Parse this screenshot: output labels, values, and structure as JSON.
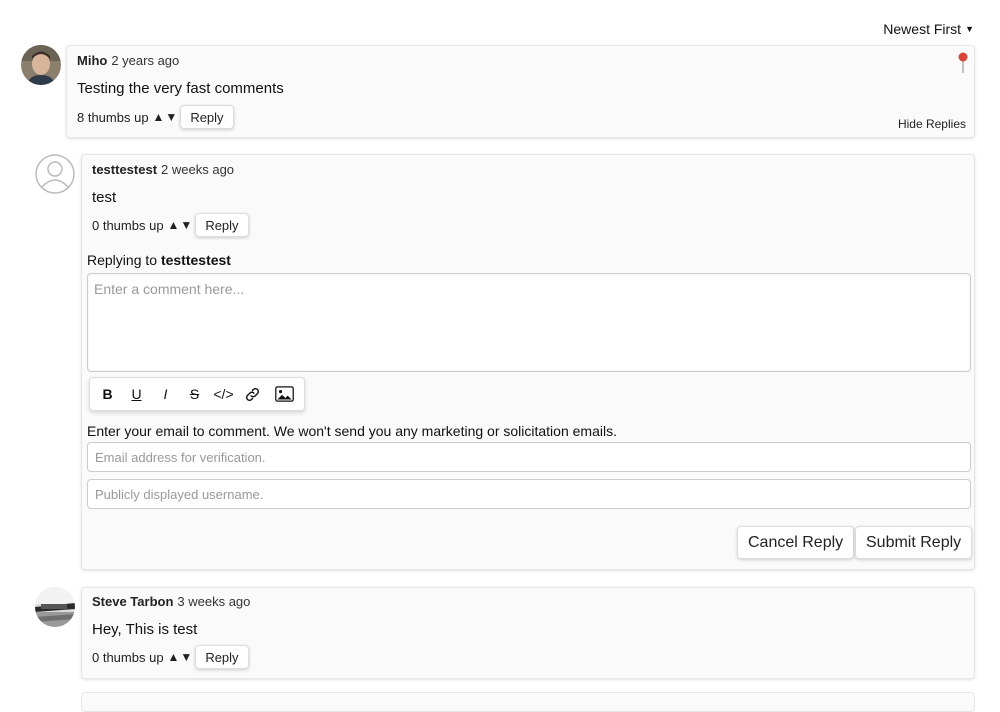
{
  "sort": {
    "label": "Newest First"
  },
  "comments": [
    {
      "author": "Miho",
      "time": "2 years ago",
      "text": "Testing the very fast comments",
      "votes": "8 thumbs up",
      "reply_label": "Reply",
      "hide_replies": "Hide Replies",
      "pinned": true
    },
    {
      "author": "testtestest",
      "time": "2 weeks ago",
      "text": "test",
      "votes": "0 thumbs up",
      "reply_label": "Reply"
    },
    {
      "author": "Steve Tarbon",
      "time": "3 weeks ago",
      "text": "Hey, This is test",
      "votes": "0 thumbs up",
      "reply_label": "Reply"
    }
  ],
  "vote_arrows": "▲▼",
  "reply_form": {
    "replying_prefix": "Replying to",
    "replying_to": "testtestest",
    "comment_placeholder": "Enter a comment here...",
    "toolbar": {
      "bold": "B",
      "underline": "U",
      "italic": "I",
      "strike": "S",
      "code": "</>",
      "link_icon": "link-icon",
      "image_icon": "image-icon"
    },
    "email_note": "Enter your email to comment. We won't send you any marketing or solicitation emails.",
    "email_placeholder": "Email address for verification.",
    "username_placeholder": "Publicly displayed username.",
    "cancel_label": "Cancel Reply",
    "submit_label": "Submit Reply"
  },
  "colors": {
    "pin": "#d9453b",
    "card_bg": "#fafafa"
  }
}
